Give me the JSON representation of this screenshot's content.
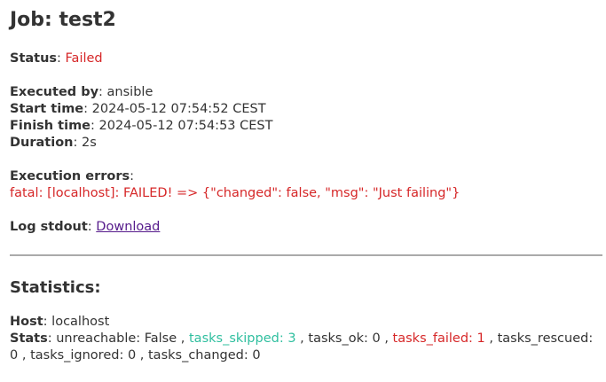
{
  "job": {
    "heading": "Job: test2"
  },
  "status": {
    "label": "Status",
    "value": "Failed"
  },
  "executed_by": {
    "label": "Executed by",
    "value": "ansible"
  },
  "start_time": {
    "label": "Start time",
    "value": "2024-05-12 07:54:52 CEST"
  },
  "finish_time": {
    "label": "Finish time",
    "value": "2024-05-12 07:54:53 CEST"
  },
  "duration": {
    "label": "Duration",
    "value": "2s"
  },
  "execution_errors": {
    "label": "Execution errors",
    "message": "fatal: [localhost]: FAILED! => {\"changed\": false, \"msg\": \"Just failing\"}"
  },
  "log_stdout": {
    "label": "Log stdout",
    "link_text": "Download"
  },
  "statistics": {
    "heading": "Statistics:",
    "host_label": "Host",
    "host_value": "localhost",
    "stats_label": "Stats",
    "unreachable": "unreachable: False ,",
    "tasks_skipped": "tasks_skipped: 3",
    "tasks_ok": ", tasks_ok: 0 ,",
    "tasks_failed": "tasks_failed: 1",
    "tasks_rescued": ", tasks_rescued: 0 ,",
    "tasks_ignored_changed": "tasks_ignored: 0 , tasks_changed: 0"
  },
  "colors": {
    "failed": "#d62728",
    "skipped": "#2fbf9f",
    "link": "#551a8b",
    "text": "#333333"
  }
}
